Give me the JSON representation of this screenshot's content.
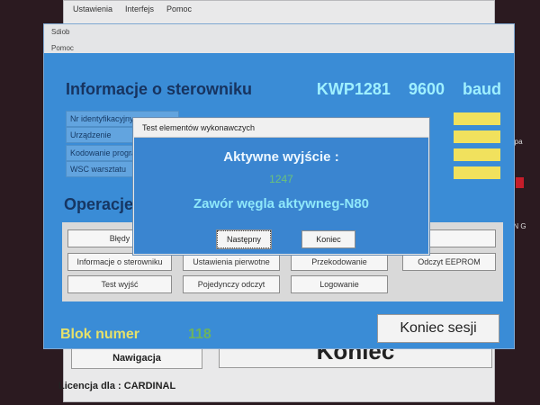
{
  "background_window": {
    "menu": [
      "Ustawienia",
      "Interfejs",
      "Pomoc"
    ],
    "nawigacja_button": "Nawigacja",
    "koniec_label": "Koniec",
    "licencja": "Licencja dla : CARDINAL"
  },
  "side_fragments": {
    "right_text1": "mpa",
    "right_text2": "EN G"
  },
  "main_window": {
    "title": "Sdiob",
    "menu": "Pomoc",
    "header": "Informacje o sterowniku",
    "protocol": "KWP1281",
    "baud_value": "9600",
    "baud_unit": "baud",
    "info_labels": [
      "Nr identyfikacyjny",
      "Urządzenie",
      "Kodowanie progra",
      "WSC warsztatu"
    ],
    "operacje": "Operacje",
    "buttons": {
      "bledy": "Błędy",
      "info": "Informacje o sterowniku",
      "ustawienia": "Ustawienia pierwotne",
      "przekodowanie": "Przekodowanie",
      "odczyt_eeprom": "Odczyt EEPROM",
      "test_wyjsc": "Test wyjść",
      "pojedynczy": "Pojedynczy odczyt",
      "logowanie": "Logowanie"
    },
    "blok_label": "Blok numer",
    "blok_value": "118",
    "koniec_sesji": "Koniec sesji"
  },
  "dialog": {
    "title": "Test elementów wykonawczych",
    "label": "Aktywne wyjście :",
    "value": "1247",
    "description": "Zawór węgla aktywneg-N80",
    "next_button": "Następny",
    "end_button": "Koniec"
  },
  "colors": {
    "window_blue": "#3a8cd6",
    "dialog_blue": "#3a85d0",
    "cyan_text": "#9ff0ff",
    "yellow": "#f1e15d",
    "green_value": "#6bc27a"
  }
}
